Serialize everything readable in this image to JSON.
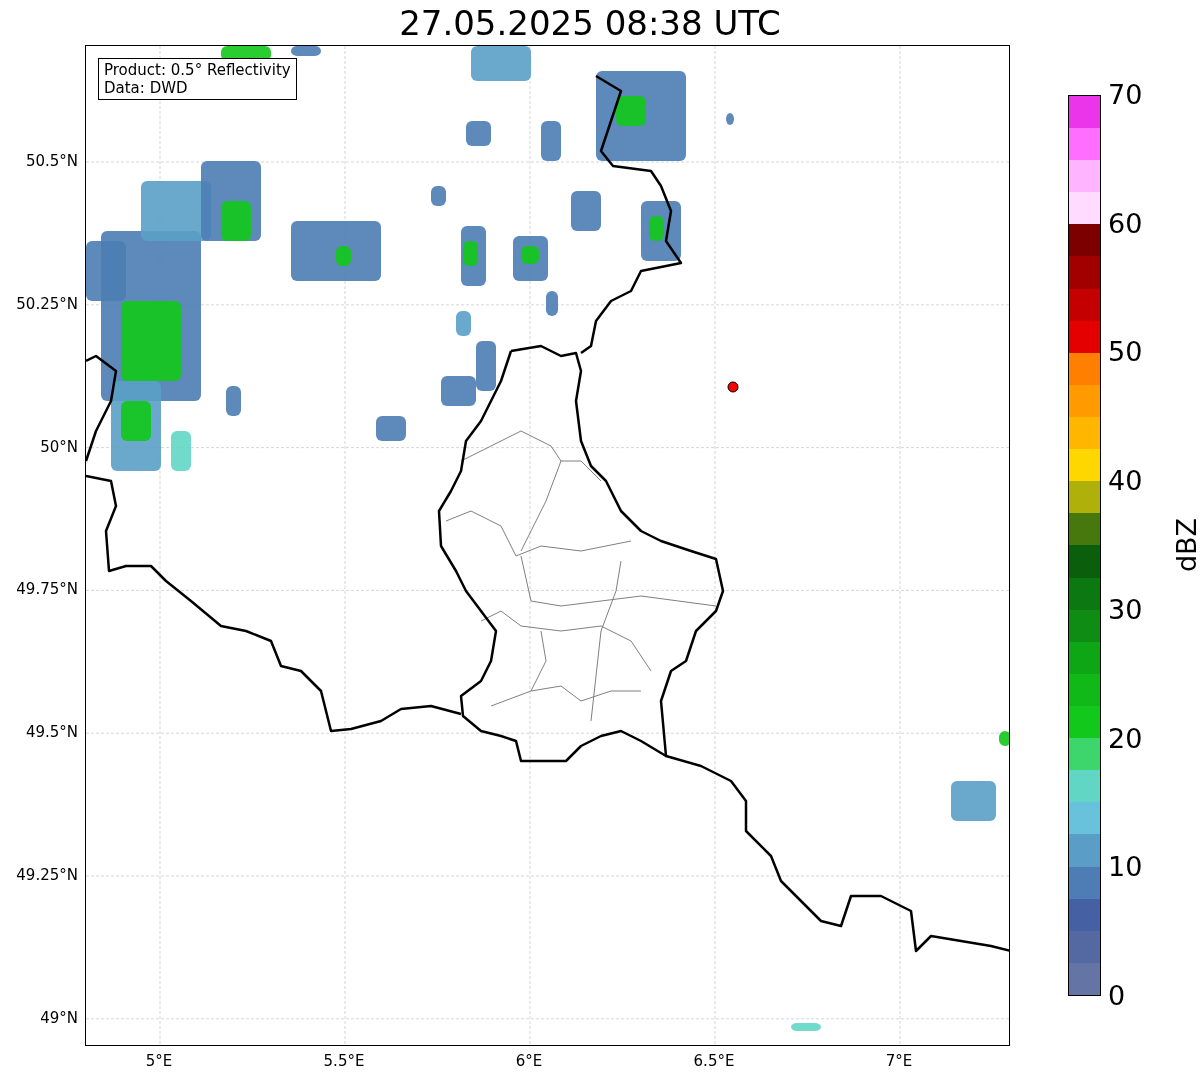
{
  "title": "27.05.2025 08:38 UTC",
  "legend": {
    "lines": [
      "Product: 0.5° Reflectivity",
      "Data: DWD"
    ]
  },
  "map": {
    "x_tick_labels": [
      "5°E",
      "5.5°E",
      "6°E",
      "6.5°E",
      "7°E"
    ],
    "y_tick_labels": [
      "50.5°N",
      "50.25°N",
      "50°N",
      "49.75°N",
      "49.5°N",
      "49.25°N",
      "49°N"
    ]
  },
  "colorbar": {
    "label": "dBZ",
    "tick_labels": [
      "70",
      "60",
      "50",
      "40",
      "30",
      "20",
      "10",
      "0"
    ],
    "bins": [
      {
        "color": "#6474a5"
      },
      {
        "color": "#5468a2"
      },
      {
        "color": "#4560a3"
      },
      {
        "color": "#4d7db4"
      },
      {
        "color": "#5a9ec7"
      },
      {
        "color": "#68c2dc"
      },
      {
        "color": "#62d6c4"
      },
      {
        "color": "#3dd66c"
      },
      {
        "color": "#12c81a"
      },
      {
        "color": "#11b918"
      },
      {
        "color": "#0fa616"
      },
      {
        "color": "#0e8c14"
      },
      {
        "color": "#0b7812"
      },
      {
        "color": "#0a5e0c"
      },
      {
        "color": "#46780d"
      },
      {
        "color": "#b0b00b"
      },
      {
        "color": "#ffd700"
      },
      {
        "color": "#ffb600"
      },
      {
        "color": "#ff9a00"
      },
      {
        "color": "#ff7f00"
      },
      {
        "color": "#e40000"
      },
      {
        "color": "#c40000"
      },
      {
        "color": "#a00000"
      },
      {
        "color": "#7d0000"
      },
      {
        "color": "#ffdcff"
      },
      {
        "color": "#ffb4ff"
      },
      {
        "color": "#ff6eff"
      },
      {
        "color": "#ea35ea"
      }
    ]
  }
}
